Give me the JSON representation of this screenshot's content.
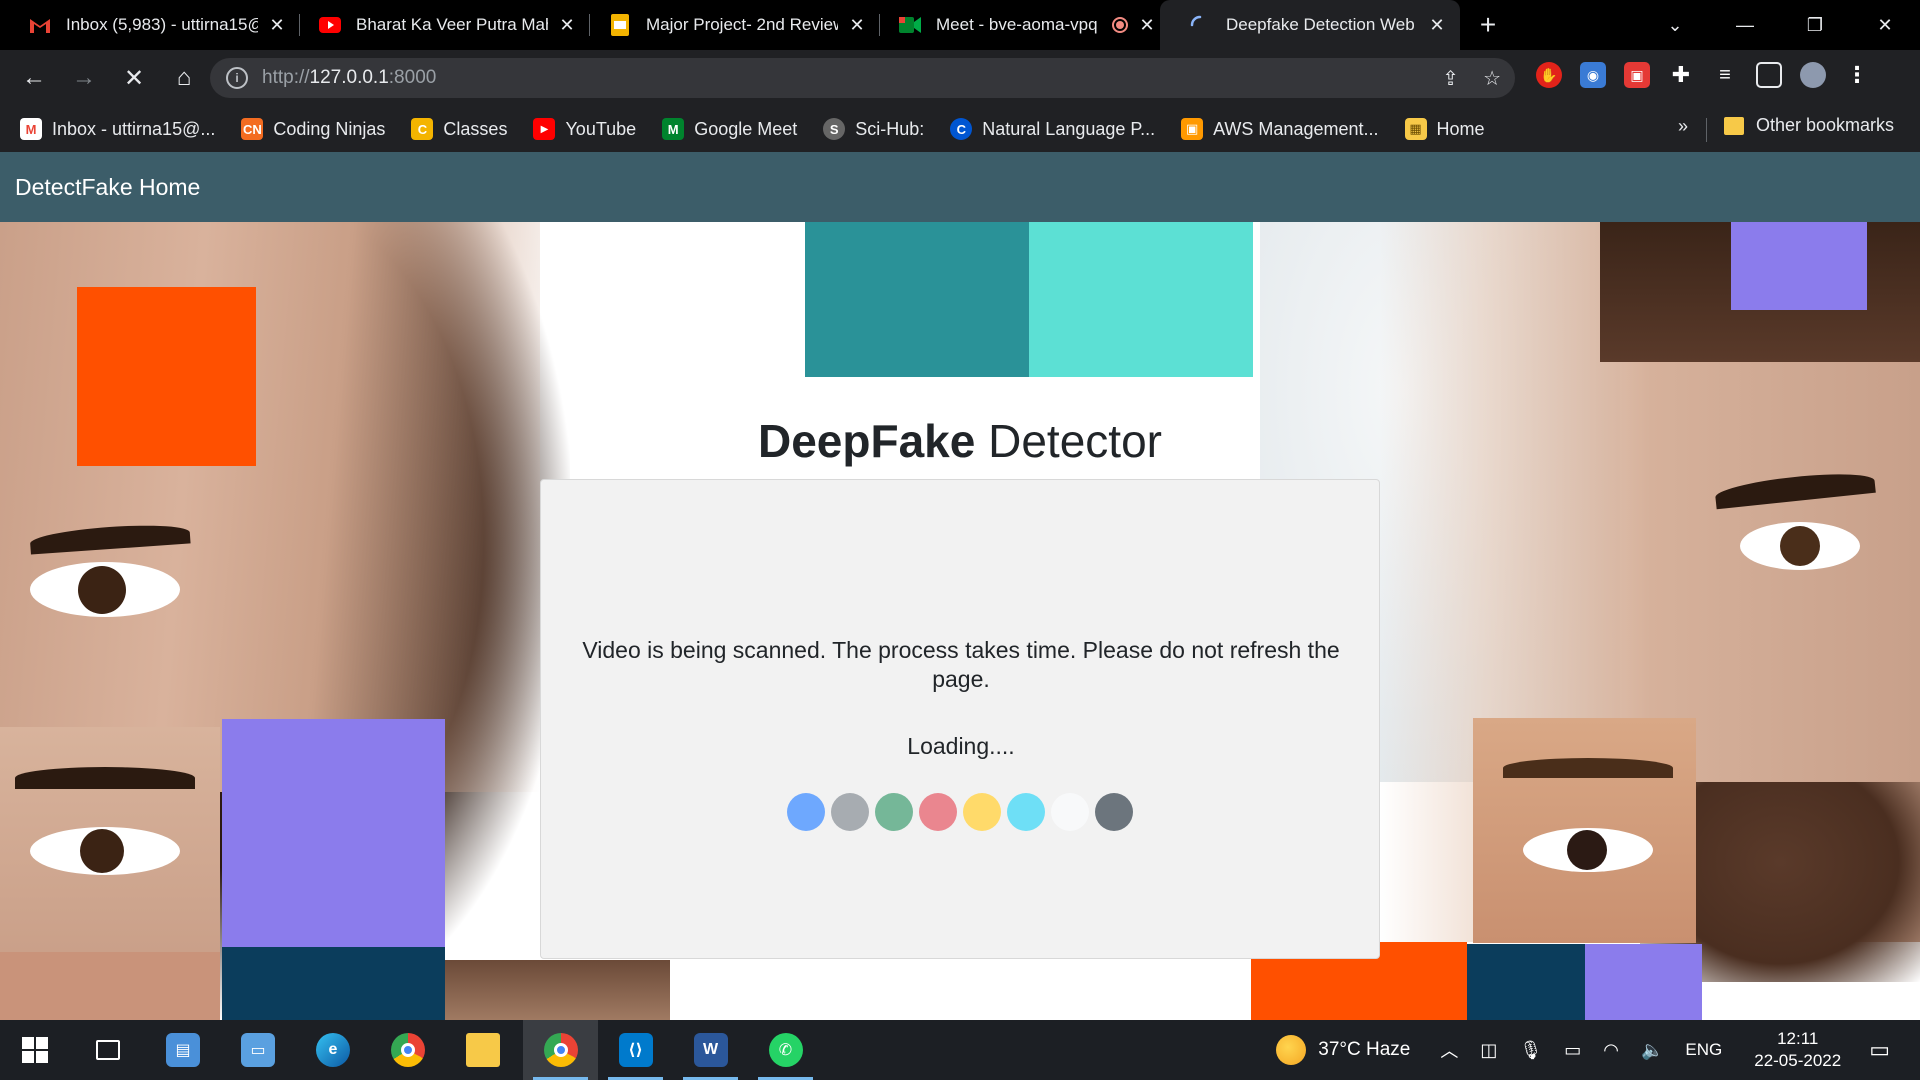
{
  "tabs": [
    {
      "title": "Inbox (5,983) - uttirna15@",
      "icon": "gmail-icon",
      "color": "#ea4335"
    },
    {
      "title": "Bharat Ka Veer Putra Mah",
      "icon": "youtube-icon",
      "color": "#ff0000"
    },
    {
      "title": "Major Project- 2nd Review",
      "icon": "slides-icon",
      "color": "#f4b400"
    },
    {
      "title": "Meet - bve-aoma-vpq",
      "icon": "meet-icon",
      "color": "#00832d"
    },
    {
      "title": "Deepfake Detection Web",
      "icon": "loading-spinner-icon",
      "color": "#8ab4f8"
    }
  ],
  "toolbar": {
    "url_scheme": "http://",
    "url_host": "127.0.0.1",
    "url_port": ":8000"
  },
  "bookmarks": [
    {
      "label": "Inbox - uttirna15@...",
      "icon": "gmail-icon",
      "color": "#ea4335",
      "glyph": "M"
    },
    {
      "label": "Coding Ninjas",
      "icon": "coding-ninjas-icon",
      "color": "#f36c21",
      "glyph": "CN"
    },
    {
      "label": "Classes",
      "icon": "classroom-icon",
      "color": "#f4b400",
      "glyph": "C"
    },
    {
      "label": "YouTube",
      "icon": "youtube-icon",
      "color": "#ff0000",
      "glyph": "▶"
    },
    {
      "label": "Google Meet",
      "icon": "meet-icon",
      "color": "#00832d",
      "glyph": "M"
    },
    {
      "label": "Sci-Hub:",
      "icon": "scihub-icon",
      "color": "#666",
      "glyph": "S"
    },
    {
      "label": "Natural Language P...",
      "icon": "coursera-icon",
      "color": "#0056d2",
      "glyph": "C"
    },
    {
      "label": "AWS Management...",
      "icon": "aws-icon",
      "color": "#ff9900",
      "glyph": "A"
    },
    {
      "label": "Home",
      "icon": "home-box-icon",
      "color": "#f7c948",
      "glyph": "H"
    }
  ],
  "bookmarks_more": "»",
  "other_bookmarks": "Other bookmarks",
  "app": {
    "brand": "DetectFake Home",
    "title_bold": "DeepFake",
    "title_rest": " Detector",
    "message": "Video is being scanned. The process takes time. Please do not refresh the page.",
    "loading": "Loading....",
    "spinner_colors": [
      "#6ea8fe",
      "#a7acb1",
      "#75b798",
      "#ea868f",
      "#ffda6a",
      "#6edff6",
      "#f8f9fa",
      "#6c757d"
    ]
  },
  "taskbar": {
    "weather": "37°C  Haze",
    "language": "ENG",
    "time": "12:11",
    "date": "22-05-2022"
  }
}
